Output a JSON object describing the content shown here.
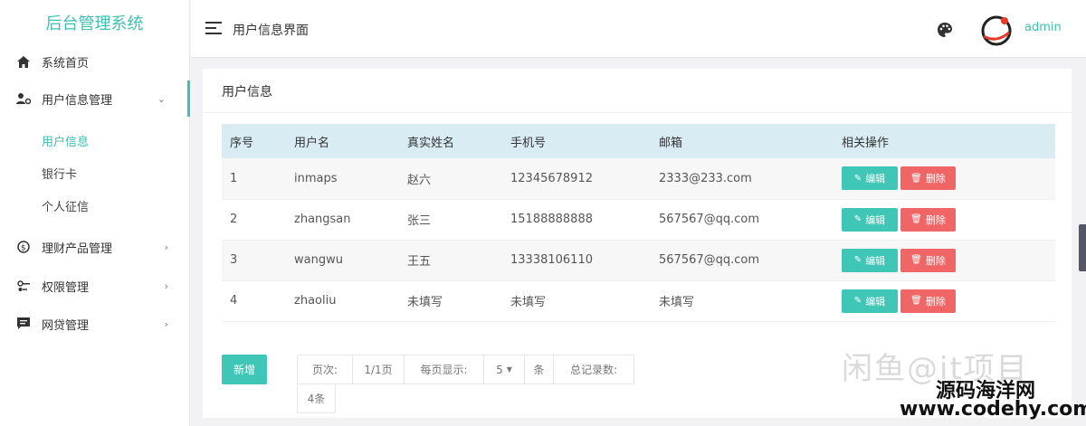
{
  "sidebar": {
    "brand": "后台管理系统",
    "items": [
      {
        "label": "系统首页"
      },
      {
        "label": "用户信息管理",
        "chev": "⌄"
      },
      {
        "label": "理财产品管理",
        "chev": "›"
      },
      {
        "label": "权限管理",
        "chev": "›"
      },
      {
        "label": "网贷管理",
        "chev": "›"
      }
    ],
    "sub": [
      {
        "label": "用户信息"
      },
      {
        "label": "银行卡"
      },
      {
        "label": "个人征信"
      }
    ]
  },
  "header": {
    "title": "用户信息界面",
    "username": "admin"
  },
  "card": {
    "title": "用户信息",
    "columns": [
      "序号",
      "用户名",
      "真实姓名",
      "手机号",
      "邮箱",
      "相关操作"
    ],
    "rows": [
      {
        "no": "1",
        "username": "inmaps",
        "realname": "赵六",
        "phone": "12345678912",
        "email": "2333@233.com"
      },
      {
        "no": "2",
        "username": "zhangsan",
        "realname": "张三",
        "phone": "15188888888",
        "email": "567567@qq.com"
      },
      {
        "no": "3",
        "username": "wangwu",
        "realname": "王五",
        "phone": "13338106110",
        "email": "567567@qq.com"
      },
      {
        "no": "4",
        "username": "zhaoliu",
        "realname": "未填写",
        "phone": "未填写",
        "email": "未填写"
      }
    ],
    "edit_label": "编辑",
    "delete_label": "删除",
    "add_label": "新增"
  },
  "pager": {
    "page_label": "页次:",
    "page_value": "1/1页",
    "per_page_label": "每页显示:",
    "per_page_value": "5",
    "unit": "条",
    "total_label": "总记录数:",
    "total_value": "4条"
  },
  "watermark": {
    "line1": "闲鱼@it项目",
    "line2": "源码海洋网",
    "line3": "www.codehy.com"
  },
  "colors": {
    "accent": "#3fbfb0",
    "danger": "#f06565",
    "table_header": "#d9ecf4"
  }
}
